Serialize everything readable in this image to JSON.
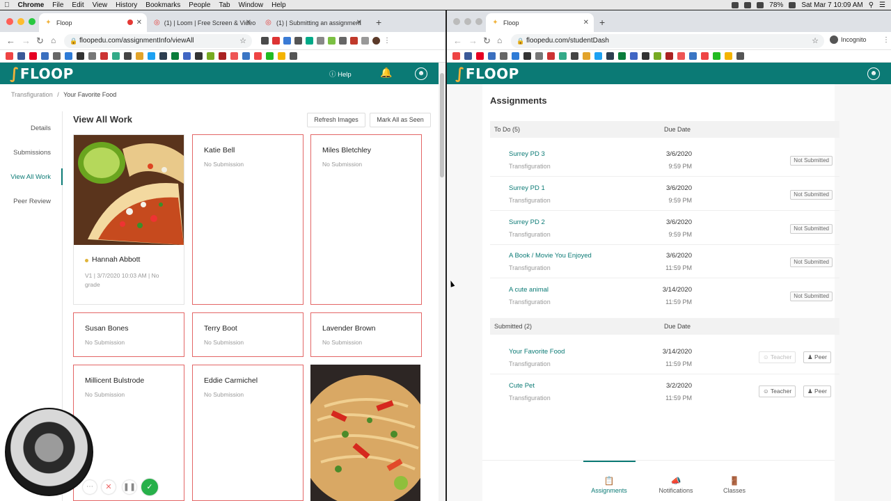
{
  "menubar": {
    "app": "Chrome",
    "items": [
      "File",
      "Edit",
      "View",
      "History",
      "Bookmarks",
      "People",
      "Tab",
      "Window",
      "Help"
    ],
    "battery": "78%",
    "clock": "Sat Mar 7  10:09 AM"
  },
  "left_window": {
    "tabs": [
      {
        "title": "Floop"
      },
      {
        "title": "(1) | Loom | Free Screen & Video"
      },
      {
        "title": "(1) | Submitting an assignment"
      }
    ],
    "url": "floopedu.com/assignmentInfo/viewAll",
    "header": {
      "logo": "FLOOP",
      "help": "Help"
    },
    "breadcrumb": {
      "parent": "Transfiguration",
      "sep": "/",
      "current": "Your Favorite Food"
    },
    "nav": [
      "Details",
      "Submissions",
      "View All Work",
      "Peer Review"
    ],
    "title": "View All Work",
    "buttons": {
      "refresh": "Refresh Images",
      "mark_seen": "Mark All as Seen"
    },
    "cards": [
      {
        "name": "Hannah Abbott",
        "meta": "V1 | 3/7/2020 10:03 AM | No grade",
        "image": "tacos"
      },
      {
        "name": "Katie Bell",
        "status": "No Submission"
      },
      {
        "name": "Miles Bletchley",
        "status": "No Submission"
      },
      {
        "name": "Susan Bones",
        "status": "No Submission"
      },
      {
        "name": "Terry Boot",
        "status": "No Submission"
      },
      {
        "name": "Lavender Brown",
        "status": "No Submission"
      },
      {
        "name": "Millicent Bulstrode",
        "status": "No Submission"
      },
      {
        "name": "Eddie Carmichel",
        "status": "No Submission"
      },
      {
        "image": "noodles"
      }
    ]
  },
  "right_window": {
    "tabs": [
      {
        "title": "Floop"
      }
    ],
    "url": "floopedu.com/studentDash",
    "incognito": "Incognito",
    "header": {
      "logo": "FLOOP"
    },
    "title": "Assignments",
    "todo_header": {
      "label": "To Do (5)",
      "due": "Due Date"
    },
    "todo": [
      {
        "title": "Surrey PD 3",
        "class": "Transfiguration",
        "date": "3/6/2020",
        "time": "9:59 PM",
        "status": "Not Submitted"
      },
      {
        "title": "Surrey PD 1",
        "class": "Transfiguration",
        "date": "3/6/2020",
        "time": "9:59 PM",
        "status": "Not Submitted"
      },
      {
        "title": "Surrey PD 2",
        "class": "Transfiguration",
        "date": "3/6/2020",
        "time": "9:59 PM",
        "status": "Not Submitted"
      },
      {
        "title": "A Book / Movie You Enjoyed",
        "class": "Transfiguration",
        "date": "3/6/2020",
        "time": "11:59 PM",
        "status": "Not Submitted"
      },
      {
        "title": "A cute animal",
        "class": "Transfiguration",
        "date": "3/14/2020",
        "time": "11:59 PM",
        "status": "Not Submitted"
      }
    ],
    "submitted_header": {
      "label": "Submitted (2)",
      "due": "Due Date"
    },
    "submitted": [
      {
        "title": "Your Favorite Food",
        "class": "Transfiguration",
        "date": "3/14/2020",
        "time": "11:59 PM",
        "teacher": "Teacher",
        "peer": "Peer"
      },
      {
        "title": "Cute Pet",
        "class": "Transfiguration",
        "date": "3/2/2020",
        "time": "11:59 PM",
        "teacher": "Teacher",
        "peer": "Peer"
      }
    ],
    "bottom_nav": [
      "Assignments",
      "Notifications",
      "Classes"
    ]
  },
  "colors": {
    "brand": "#0b7a75",
    "card_border": "#e36565",
    "logo_accent": "#f0b23a"
  }
}
